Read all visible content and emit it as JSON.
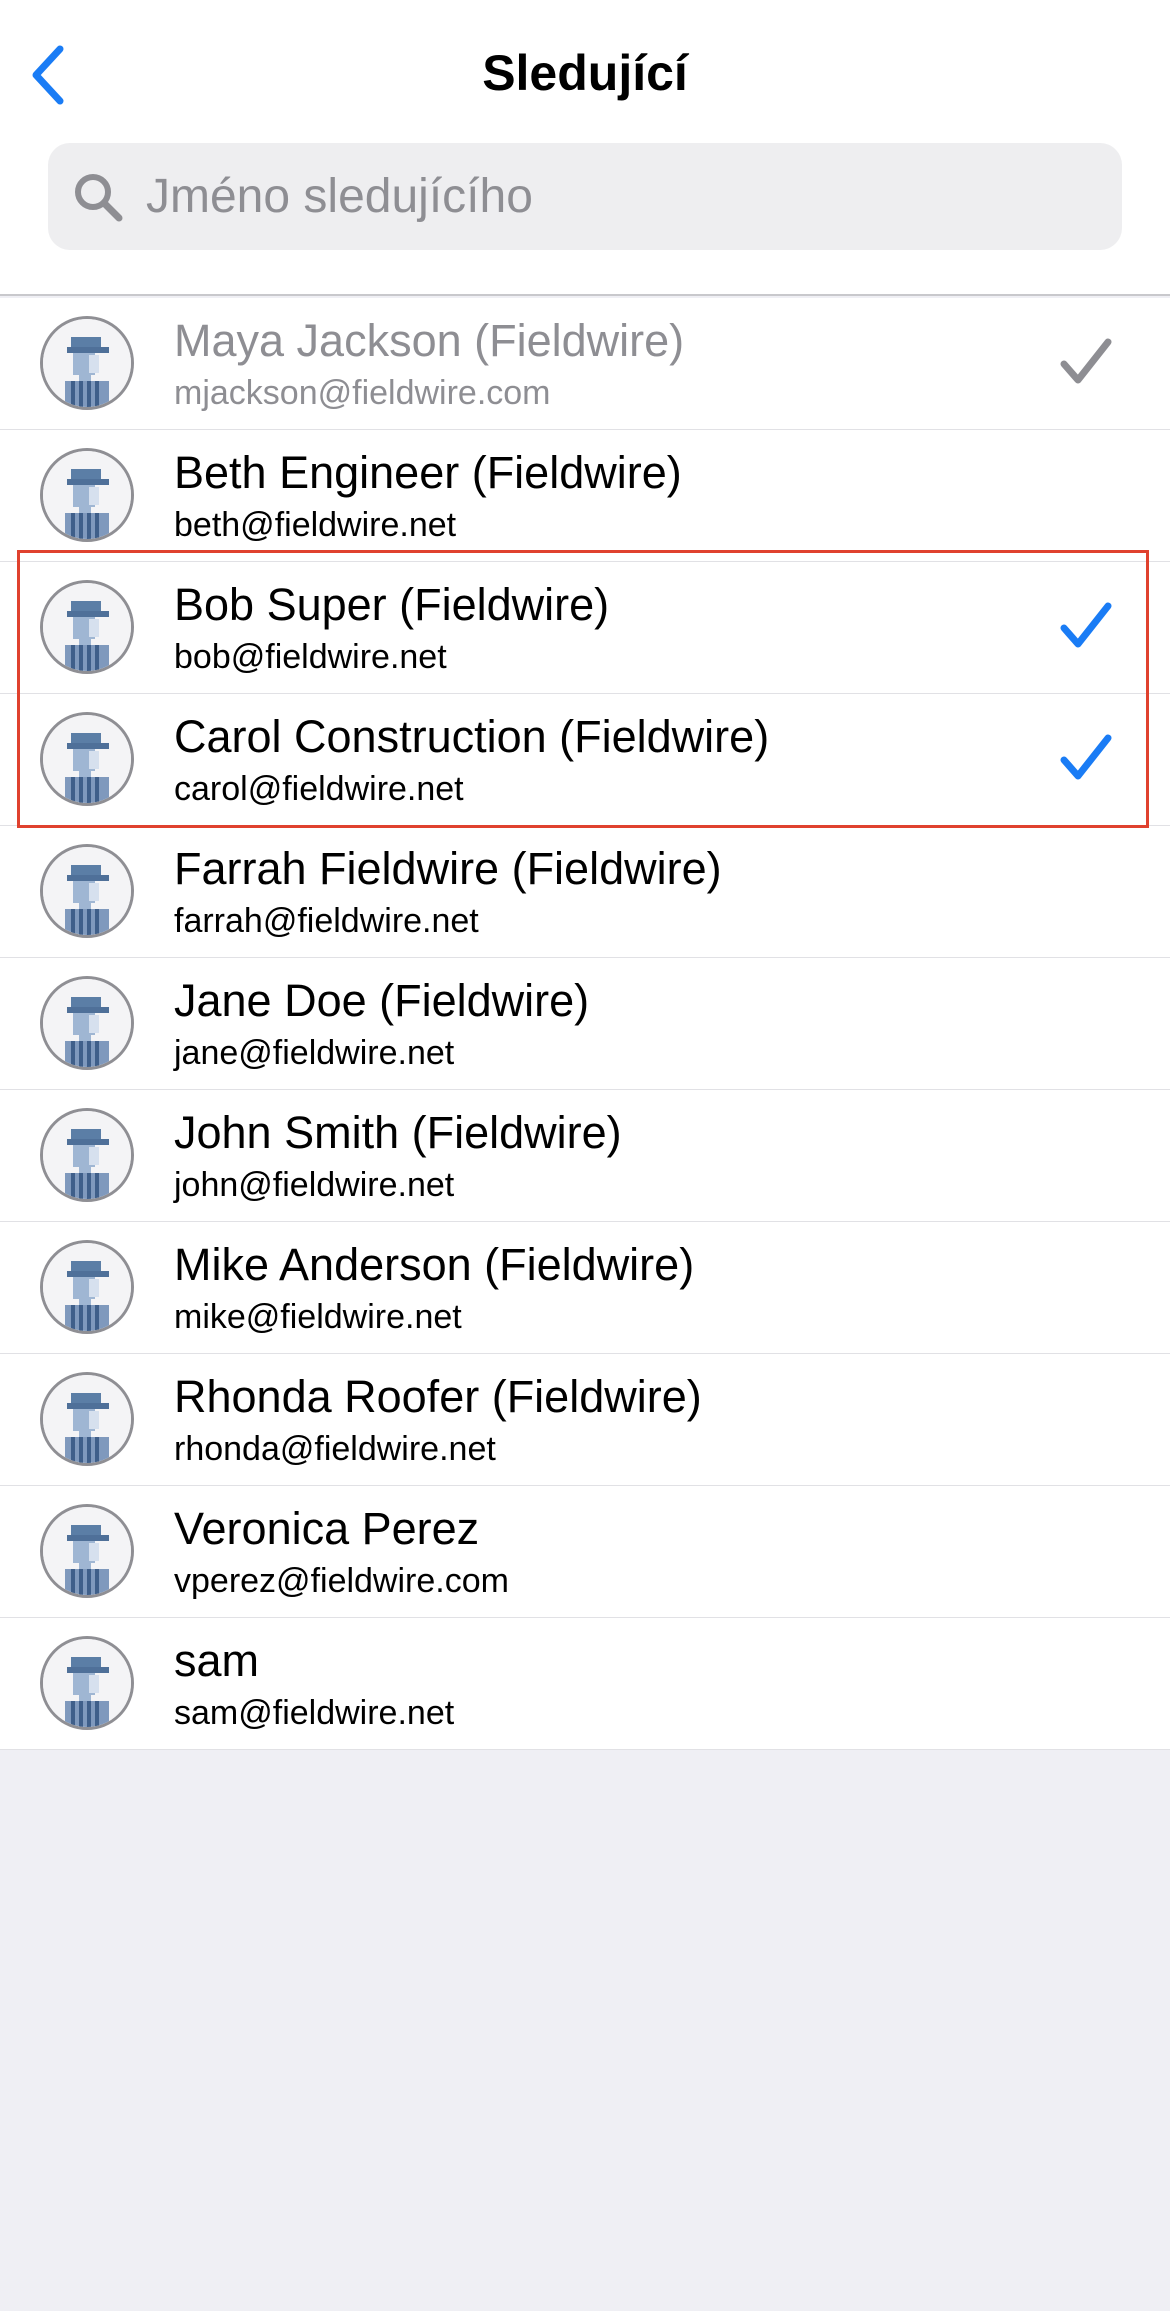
{
  "header": {
    "title": "Sledující",
    "back_icon": "chevron-left-icon"
  },
  "search": {
    "placeholder": "Jméno sledujícího",
    "value": "",
    "icon": "search-icon"
  },
  "colors": {
    "accent": "#1a7cf5",
    "disabled_text": "#8e8e93",
    "highlight_border": "#e0412e"
  },
  "followers": [
    {
      "name": "Maya Jackson (Fieldwire)",
      "email": "mjackson@fieldwire.com",
      "checked": true,
      "disabled": true
    },
    {
      "name": "Beth Engineer (Fieldwire)",
      "email": "beth@fieldwire.net",
      "checked": false,
      "disabled": false
    },
    {
      "name": "Bob Super (Fieldwire)",
      "email": "bob@fieldwire.net",
      "checked": true,
      "disabled": false
    },
    {
      "name": "Carol Construction (Fieldwire)",
      "email": "carol@fieldwire.net",
      "checked": true,
      "disabled": false
    },
    {
      "name": "Farrah Fieldwire (Fieldwire)",
      "email": "farrah@fieldwire.net",
      "checked": false,
      "disabled": false
    },
    {
      "name": "Jane Doe (Fieldwire)",
      "email": "jane@fieldwire.net",
      "checked": false,
      "disabled": false
    },
    {
      "name": "John Smith (Fieldwire)",
      "email": "john@fieldwire.net",
      "checked": false,
      "disabled": false
    },
    {
      "name": "Mike Anderson (Fieldwire)",
      "email": "mike@fieldwire.net",
      "checked": false,
      "disabled": false
    },
    {
      "name": "Rhonda Roofer (Fieldwire)",
      "email": "rhonda@fieldwire.net",
      "checked": false,
      "disabled": false
    },
    {
      "name": "Veronica Perez",
      "email": "vperez@fieldwire.com",
      "checked": false,
      "disabled": false
    },
    {
      "name": "sam",
      "email": "sam@fieldwire.net",
      "checked": false,
      "disabled": false
    }
  ]
}
